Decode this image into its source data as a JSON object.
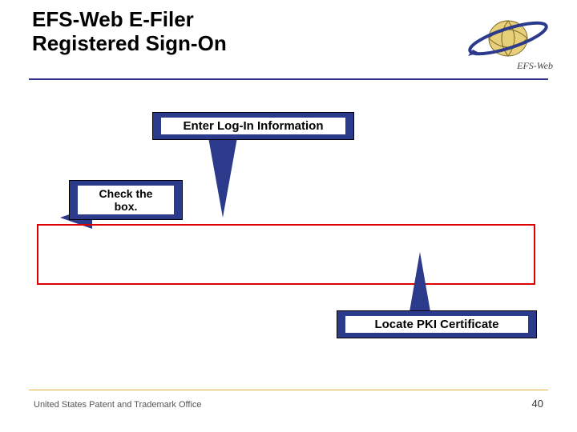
{
  "title_line1": "EFS-Web E-Filer",
  "title_line2": "Registered Sign-On",
  "logo_text": "EFS-Web",
  "callouts": {
    "enter_login": "Enter Log-In Information",
    "check_box_l1": "Check the",
    "check_box_l2": "box.",
    "locate_pki": "Locate PKI Certificate"
  },
  "footer": "United States Patent and Trademark Office",
  "page_number": "40",
  "colors": {
    "accent": "#2c3a8c",
    "rule_gold": "#e2b33a",
    "highlight_red": "#d00"
  }
}
